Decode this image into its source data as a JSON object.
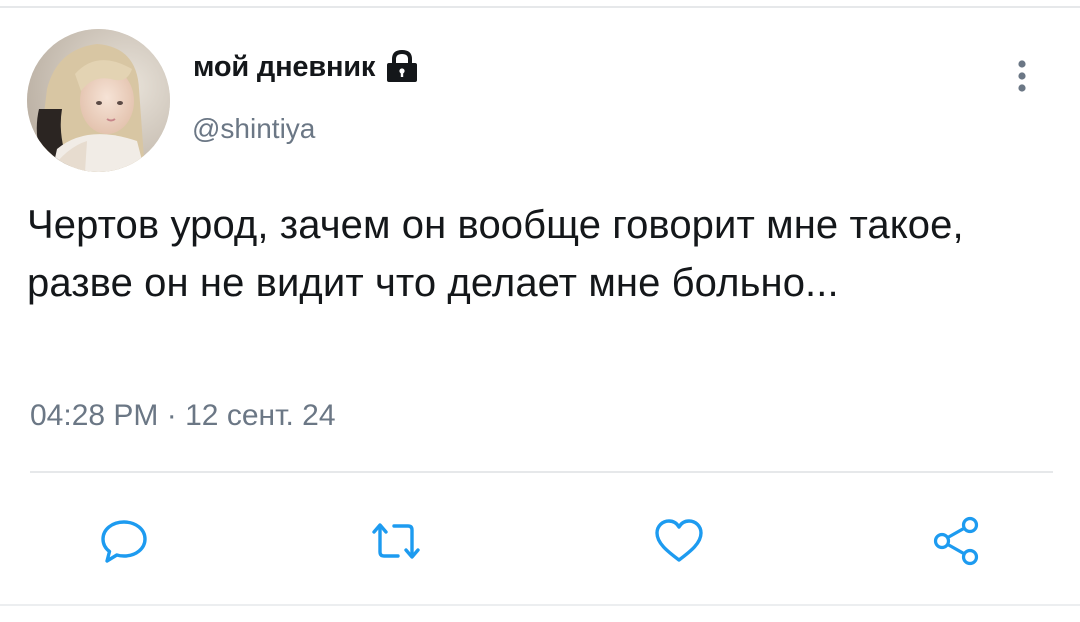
{
  "user": {
    "display_name": "мой дневник",
    "handle": "@shintiya",
    "avatar_icon": "profile-photo",
    "lock_icon": "lock-icon"
  },
  "tweet": {
    "text": "Чертов урод, зачем он вообще говорит мне такое, разве он не видит что делает мне больно...",
    "time": "04:28 PM",
    "separator": "·",
    "date": "12 сент. 24"
  },
  "actions": [
    {
      "name": "reply",
      "icon": "speech-bubble-icon"
    },
    {
      "name": "retweet",
      "icon": "retweet-icon"
    },
    {
      "name": "like",
      "icon": "heart-icon"
    },
    {
      "name": "share",
      "icon": "share-icon"
    }
  ],
  "colors": {
    "text_primary": "#14171a",
    "text_secondary": "#6b7785",
    "icon": "#1d9bf0",
    "divider": "#e6e8ea"
  }
}
